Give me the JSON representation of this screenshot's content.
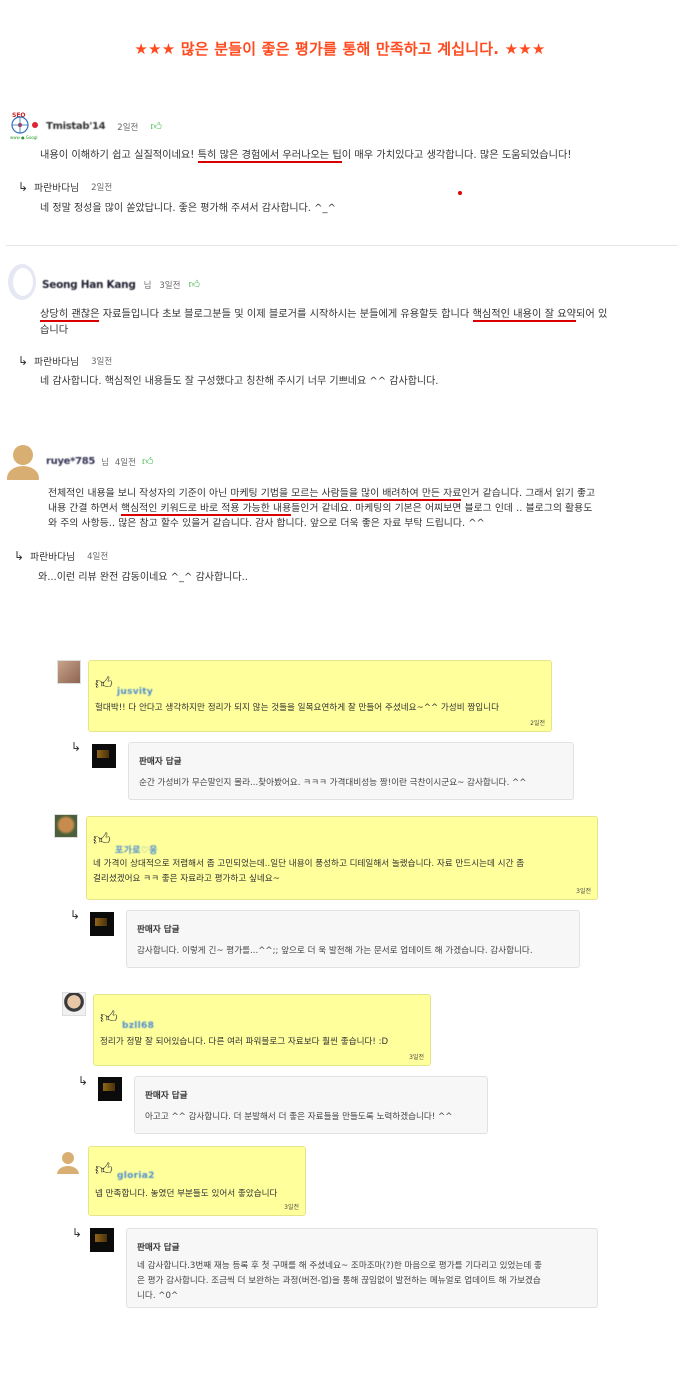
{
  "banner": "★★★ 많은 분들이 좋은 평가를 통해 만족하고 계십니다. ★★★",
  "reviews": [
    {
      "nick": "Tmistab'14",
      "when": "2일전",
      "text_plain1": "내용이 이해하기 쉽고 실질적이네요! ",
      "text_ul1": "특히 많은 경험에서 우러나오는 팁",
      "text_plain2": "이 매우 가치있다고 생각합니다. 많은 도움되었습니다!",
      "reply_author": "파란바다님",
      "reply_when": "2일전",
      "reply_text": "네 정말 정성을 많이 쏟았답니다. 좋은 평가해 주셔서 감사합니다. ^_^"
    },
    {
      "nick": "Seong Han Kang",
      "nim": "님",
      "when": "3일전",
      "line1_ul1": "상당히 괜찮은",
      "line1_plain1": " 자료들입니다 초보 블로그분들 및 이제 블로거를 시작하시는 분들에게 유용할듯 합니다 ",
      "line1_ul2": "핵심적인 내용이 잘 요약",
      "line1_plain2": "되어 있",
      "line2": "습니다",
      "reply_author": "파란바다님",
      "reply_when": "3일전",
      "reply_text": "네 감사합니다. 핵심적인 내용들도 잘 구성했다고 칭찬해 주시기 너무 기쁘네요 ^^ 감사합니다."
    },
    {
      "nick": "ruye*785",
      "nim": "님",
      "when": "4일전",
      "l1_plain1": "전체적인 내용을 보니 작성자의 기준이 아닌 ",
      "l1_ul": "마케팅 기법을 모르는 사람들을 많이 배려하여 만든 자료",
      "l1_plain2": "인거 같습니다. 그래서 읽기 좋고",
      "l2_plain1": "내용 간결 하면서 ",
      "l2_ul": "핵심적인 키워드로 바로 적용 가능한 내용",
      "l2_plain2": "들인거 같네요. 마케팅의 기본은 어찌보면 블로그 인데 .. 블로그의 활용도",
      "l3": "와 주의 사항등.. 많은 참고 할수 있을거 같습니다. 감사 합니다. 앞으로 더욱 좋은 자료 부탁 드립니다. ^^",
      "reply_author": "파란바다님",
      "reply_when": "4일전",
      "reply_text": "와...이런 리뷰 완전 감동이네요 ^_^ 감사합니다.."
    }
  ],
  "shop_reviews": [
    {
      "name": "jusvity",
      "text": "헐대박!! 다 안다고 생각하지만 정리가 되지 않는 것들을 일목요연하게 잘 만들어 주셨네요~^^ 가성비 짱입니다",
      "date": "2일전",
      "reply_title": "판매자 답글",
      "reply": "순간 가성비가 무슨말인지 몰라...찾아봤어요. ㅋㅋㅋ 가격대비성능 짱!이란 극찬이시군요~ 감사합니다. ^^"
    },
    {
      "name": "포가로♡웅",
      "text_l1": "네 가격이 상대적으로 저렴해서 좀 고민되었는데..일단 내용이 풍성하고 디테일해서 놀랬습니다. 자료 만드시는데 시간 좀",
      "text_l2": "걸리셨겠어요 ㅋㅋ 좋은 자료라고 평가하고 싶네요~",
      "date": "3일전",
      "reply_title": "판매자 답글",
      "reply": "감사합니다. 이렇게 긴~ 평가를...^^;; 앞으로 더 욱 발전해 가는 문서로 업데이트 해 가겠습니다. 감사합니다."
    },
    {
      "name": "bzll68",
      "text": "정리가 정말 잘 되어있습니다. 다른 여러 파워블로그 자료보다 훨씬 좋습니다! :D",
      "date": "3일전",
      "reply_title": "판매자 답글",
      "reply": "아고고 ^^ 감사합니다. 더 분발해서 더 좋은 자료들을 만들도록 노력하겠습니다! ^^"
    },
    {
      "name": "gloria2",
      "text": "넵 만족합니다. 놓였던 부분들도 있어서 좋았습니다",
      "date": "3일전",
      "reply_title": "판매자 답글",
      "reply_l1": "네 감사합니다.3번째 재능 등록 후 첫 구매를 해 주셨네요~ 조마조마(?)한 마음으로 평가를 기다리고 있었는데 좋",
      "reply_l2": "은 평가 감사합니다. 조금씩 더 보완하는 과정(버전-업)을 통해 끊임없이 발전하는 메뉴얼로 업데이트 해 가보겠습",
      "reply_l3": "니다. ^0^"
    }
  ]
}
